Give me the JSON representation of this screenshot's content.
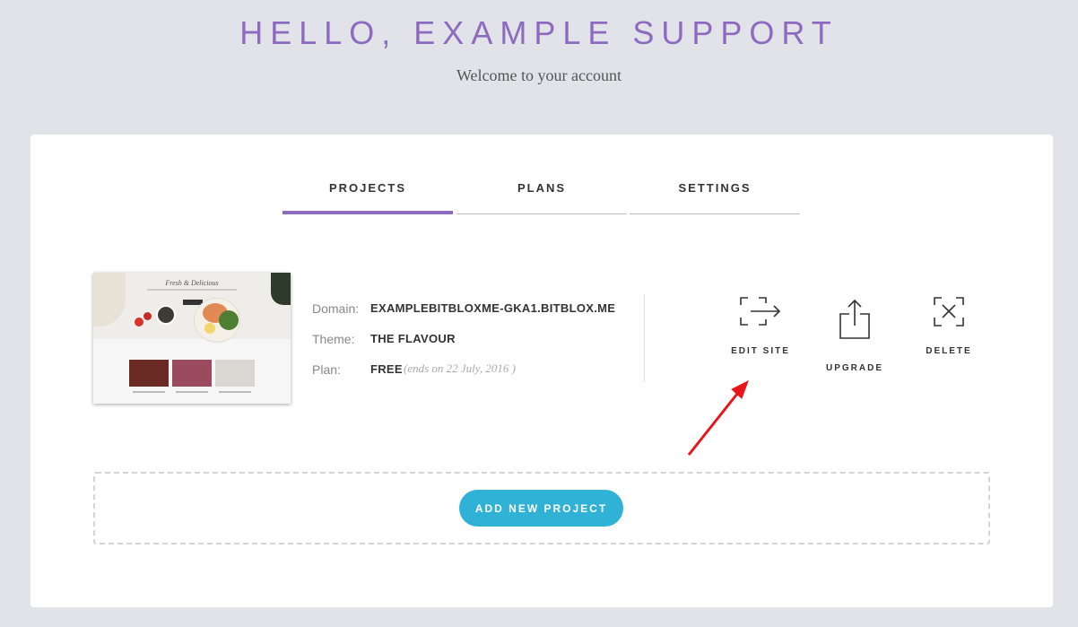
{
  "header": {
    "greeting": "HELLO, EXAMPLE SUPPORT",
    "subtitle": "Welcome to your account"
  },
  "tabs": [
    {
      "label": "PROJECTS",
      "active": true
    },
    {
      "label": "PLANS",
      "active": false
    },
    {
      "label": "SETTINGS",
      "active": false
    }
  ],
  "project": {
    "thumbnail": {
      "title": "Fresh & Delicious"
    },
    "domain_label": "Domain:",
    "domain_value": "EXAMPLEBITBLOXME-GKA1.BITBLOX.ME",
    "theme_label": "Theme:",
    "theme_value": "THE FLAVOUR",
    "plan_label": "Plan:",
    "plan_value": "FREE",
    "plan_note": "(ends on 22 July, 2016 )",
    "actions": [
      {
        "label": "EDIT SITE",
        "icon": "edit-site-icon"
      },
      {
        "label": "UPGRADE",
        "icon": "upgrade-icon"
      },
      {
        "label": "DELETE",
        "icon": "delete-icon"
      }
    ]
  },
  "add_project_label": "ADD NEW PROJECT",
  "colors": {
    "accent": "#8d6bc0",
    "button": "#2fb2d6",
    "background": "#e2e2e9",
    "annotation_arrow": "#e8141a"
  }
}
